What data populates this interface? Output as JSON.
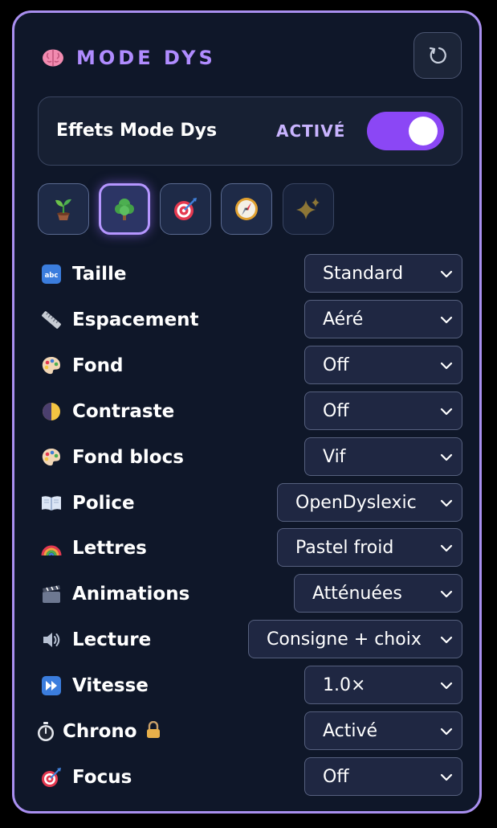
{
  "header": {
    "title": "MODE DYS",
    "title_icon": "brain-icon",
    "reset_icon": "reset-icon"
  },
  "toggle": {
    "label": "Effets Mode Dys",
    "state_text": "ACTIVÉ",
    "on": true,
    "accent": "#8b47f5"
  },
  "presets": [
    {
      "icon": "seedling-icon",
      "active": false
    },
    {
      "icon": "tree-icon",
      "active": true
    },
    {
      "icon": "target-icon",
      "active": false
    },
    {
      "icon": "compass-icon",
      "active": false
    },
    {
      "icon": "sparkles-icon",
      "active": false
    }
  ],
  "settings": [
    {
      "icon": "abc-icon",
      "label": "Taille",
      "value": "Standard"
    },
    {
      "icon": "ruler-icon",
      "label": "Espacement",
      "value": "Aéré"
    },
    {
      "icon": "palette-icon",
      "label": "Fond",
      "value": "Off"
    },
    {
      "icon": "contrast-icon",
      "label": "Contraste",
      "value": "Off"
    },
    {
      "icon": "palette-icon",
      "label": "Fond blocs",
      "value": "Vif"
    },
    {
      "icon": "book-icon",
      "label": "Police",
      "value": "OpenDyslexic"
    },
    {
      "icon": "rainbow-icon",
      "label": "Lettres",
      "value": "Pastel froid"
    },
    {
      "icon": "clapper-icon",
      "label": "Animations",
      "value": "Atténuées"
    },
    {
      "icon": "speaker-icon",
      "label": "Lecture",
      "value": "Consigne + choix"
    },
    {
      "icon": "fast-forward-icon",
      "label": "Vitesse",
      "value": "1.0×"
    },
    {
      "icon": "stopwatch-icon",
      "label": "Chrono",
      "value": "Activé",
      "locked": true
    },
    {
      "icon": "target-icon",
      "label": "Focus",
      "value": "Off"
    }
  ],
  "colors": {
    "border": "#a98ff0",
    "title": "#b08cff",
    "panel_bg": "#0f1729"
  }
}
